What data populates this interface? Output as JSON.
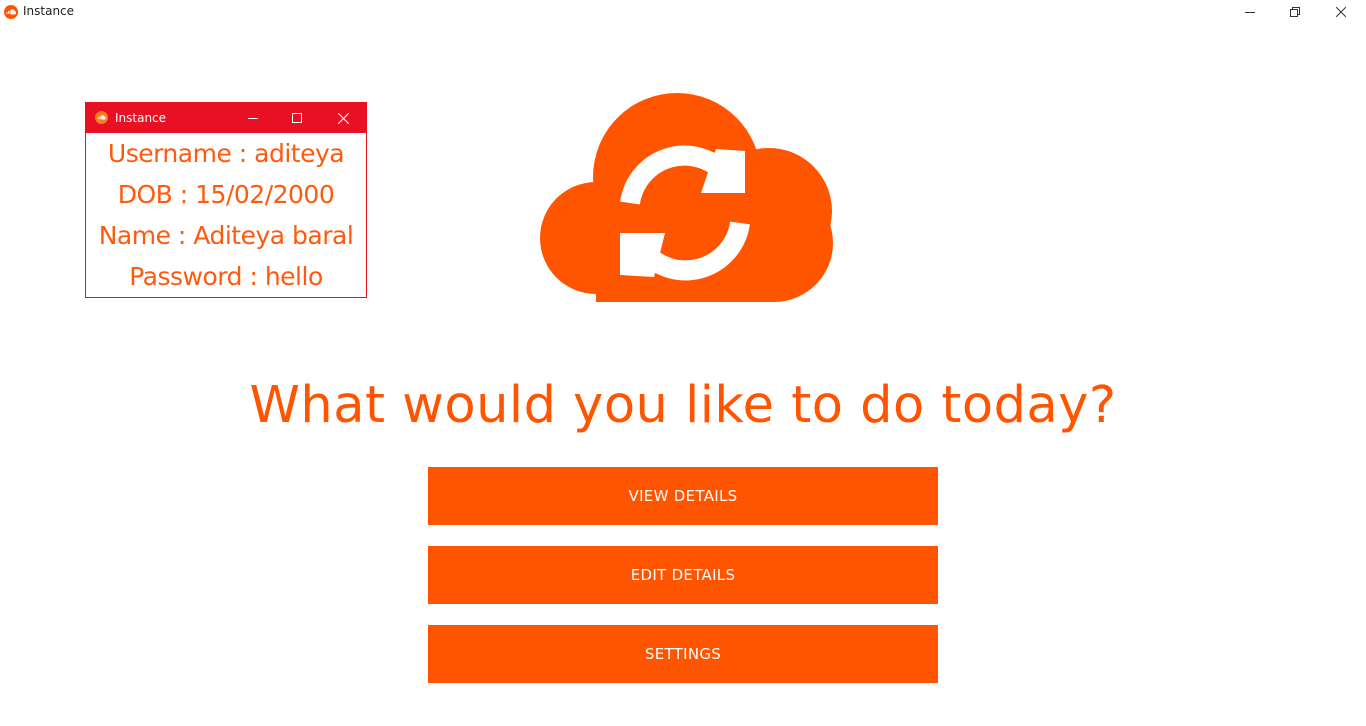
{
  "window": {
    "title": "Instance",
    "icon": "soundcloud-cloud-icon",
    "controls": [
      "minimize-icon",
      "restore-icon",
      "close-icon"
    ]
  },
  "popup": {
    "title": "Instance",
    "icon": "soundcloud-cloud-icon",
    "controls": [
      "minimize-icon",
      "maximize-icon",
      "close-icon"
    ],
    "lines": [
      "Username : aditeya",
      "DOB : 15/02/2000",
      "Name : Aditeya baral",
      "Password : hello"
    ]
  },
  "logo": {
    "icon": "cloud-sync-icon"
  },
  "main": {
    "headline": "What would you like to do today?",
    "buttons": [
      {
        "label": "VIEW DETAILS"
      },
      {
        "label": "EDIT DETAILS"
      },
      {
        "label": "SETTINGS"
      }
    ]
  },
  "colors": {
    "accent": "#ff5500",
    "popup_titlebar": "#e81123",
    "background": "#ffffff"
  }
}
